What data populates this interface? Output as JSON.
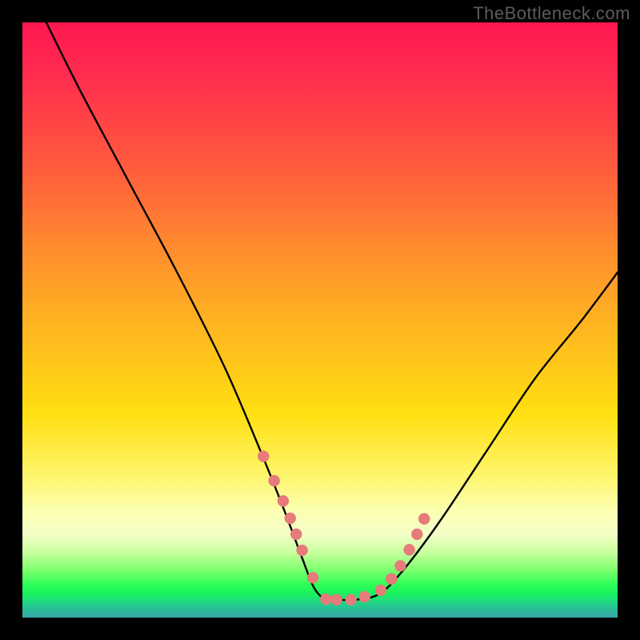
{
  "watermark": "TheBottleneck.com",
  "chart_data": {
    "type": "line",
    "title": "",
    "xlabel": "",
    "ylabel": "",
    "xlim": [
      0,
      100
    ],
    "ylim": [
      0,
      100
    ],
    "series": [
      {
        "name": "curve",
        "x": [
          4,
          10,
          18,
          26,
          34,
          40,
          44,
          47,
          49,
          51,
          53,
          56,
          60,
          64,
          70,
          78,
          86,
          94,
          100
        ],
        "y": [
          100,
          88,
          73,
          58,
          42,
          28,
          18,
          10,
          5,
          3,
          3,
          3,
          4,
          8,
          16,
          28,
          40,
          50,
          58
        ]
      }
    ],
    "markers": {
      "name": "highlight-dots",
      "color": "#e77a7a",
      "x": [
        40.5,
        42.3,
        43.8,
        45.0,
        46.0,
        47.0,
        48.8,
        51.0,
        52.8,
        55.2,
        57.5,
        60.2,
        62.0,
        63.5,
        65.0,
        66.3,
        67.5
      ],
      "y": [
        27.1,
        23.0,
        19.6,
        16.7,
        14.0,
        11.3,
        6.7,
        3.1,
        3.0,
        3.0,
        3.5,
        4.6,
        6.5,
        8.7,
        11.4,
        14.0,
        16.6
      ]
    },
    "gradient_stops": [
      {
        "pos": 0.0,
        "color": "#ff1750"
      },
      {
        "pos": 0.5,
        "color": "#ffce15"
      },
      {
        "pos": 0.82,
        "color": "#fbffb0"
      },
      {
        "pos": 0.94,
        "color": "#2dff58"
      },
      {
        "pos": 1.0,
        "color": "#36a7a8"
      }
    ]
  }
}
